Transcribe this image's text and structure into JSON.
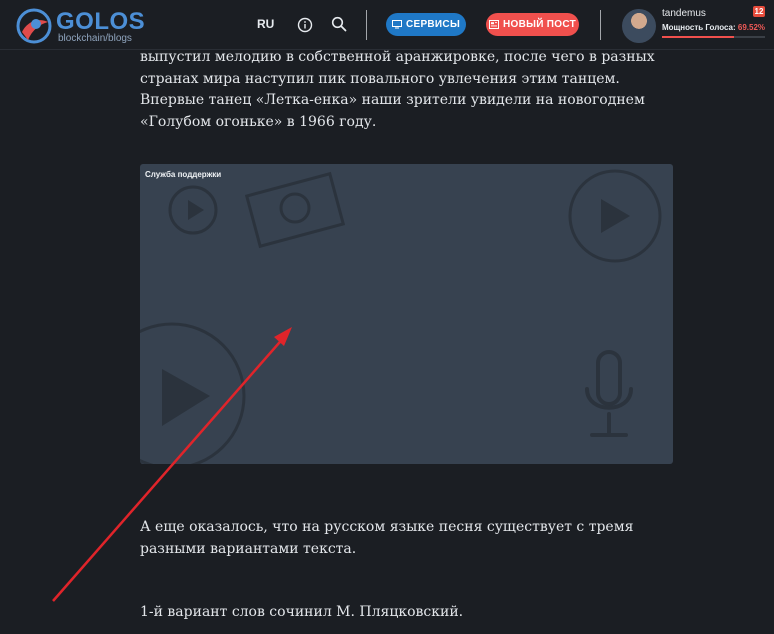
{
  "header": {
    "brand": "GOLOS",
    "tagline": "blockchain/blogs",
    "language": "RU",
    "services_label": "СЕРВИСЫ",
    "new_post_label": "НОВЫЙ ПОСТ",
    "user": {
      "name": "tandemus",
      "notifications": "12",
      "power_label": "Мощность Голоса:",
      "power_value": "69.52%",
      "power_fraction": 0.6952
    },
    "icons": [
      "info-icon",
      "search-icon",
      "monitor-icon",
      "newspaper-icon"
    ]
  },
  "article": {
    "paragraph1": "выпустил мелодию в собственной аранжировке, после чего в разных странах мира наступил пик повального увлечения этим танцем.",
    "paragraph1b": "Впервые танец «Летка-енка» наши зрители увидели на новогоднем «Голубом огоньке» в 1966 году.",
    "paragraph2": "А еще оказалось, что на русском языке песня существует с тремя разными вариантами текста.",
    "paragraph3": "1-й вариант слов сочинил М. Пляцковский."
  },
  "video": {
    "title": "Служба поддержки"
  },
  "colors": {
    "background": "#1b1e23",
    "brand_blue": "#4c8fd6",
    "services_button": "#1f78c6",
    "new_post_button": "#f0504d",
    "video_background": "#374250",
    "annotation_arrow": "#e0242a"
  }
}
